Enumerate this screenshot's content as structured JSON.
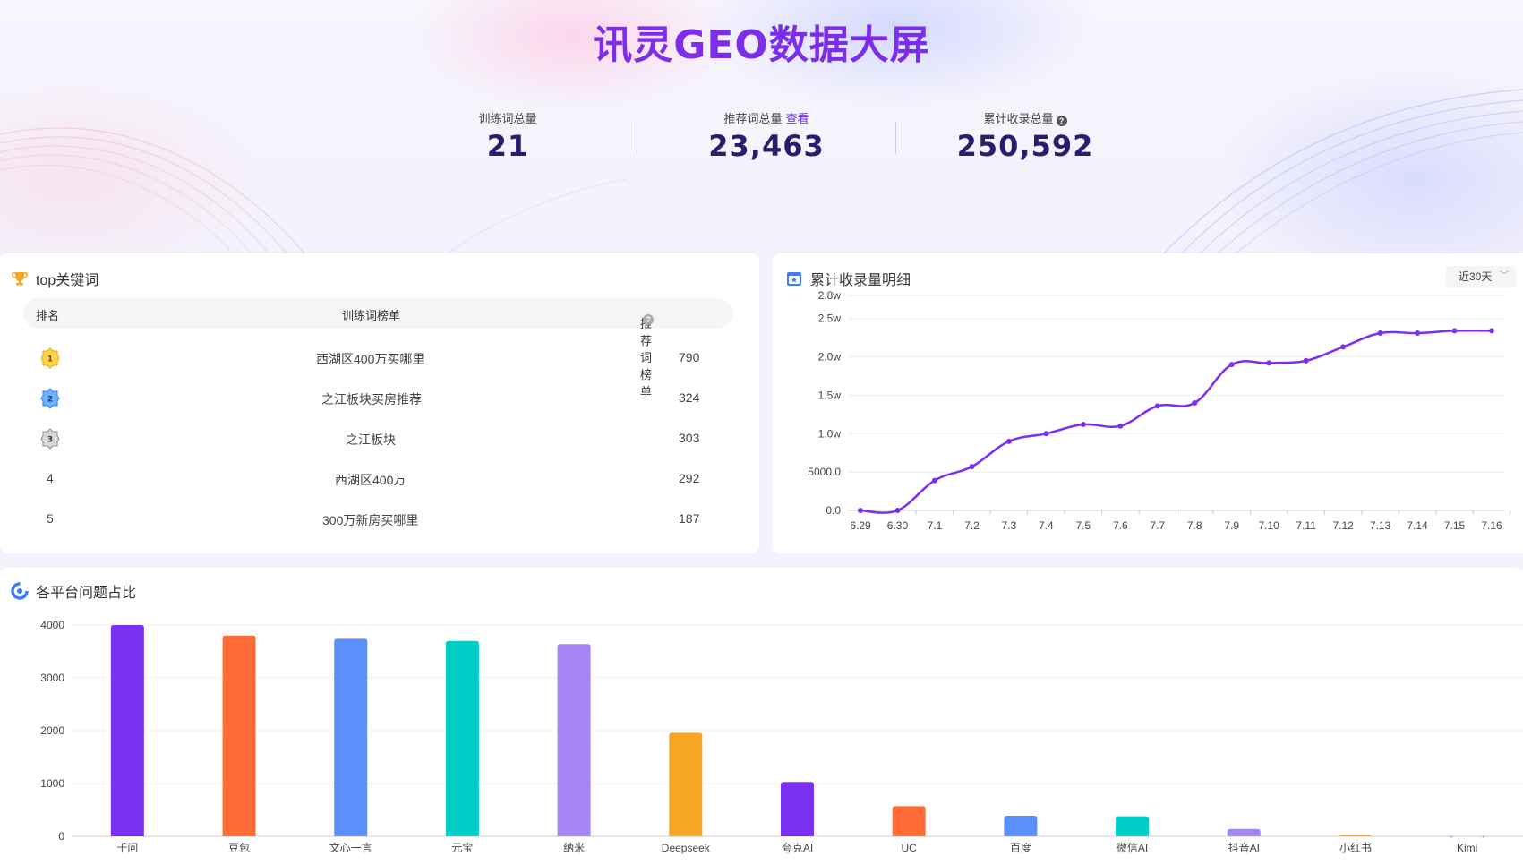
{
  "header": {
    "title": "讯灵GEO数据大屏"
  },
  "stats": [
    {
      "label": "训练词总量",
      "value": "21"
    },
    {
      "label": "推荐词总量",
      "link": "查看",
      "value": "23,463"
    },
    {
      "label": "累计收录总量",
      "help": "?",
      "value": "250,592"
    }
  ],
  "top_keywords": {
    "title": "top关键词",
    "columns": [
      "排名",
      "训练词榜单",
      "推荐词榜单"
    ],
    "help": "?",
    "rows": [
      {
        "rank": "1",
        "keyword": "西湖区400万买哪里",
        "count": "790"
      },
      {
        "rank": "2",
        "keyword": "之江板块买房推荐",
        "count": "324"
      },
      {
        "rank": "3",
        "keyword": "之江板块",
        "count": "303"
      },
      {
        "rank": "4",
        "keyword": "西湖区400万",
        "count": "292"
      },
      {
        "rank": "5",
        "keyword": "300万新房买哪里",
        "count": "187"
      }
    ]
  },
  "cumulative": {
    "title": "累计收录量明细",
    "range_select": "近30天"
  },
  "platforms": {
    "title": "各平台问题占比"
  },
  "chart_data": [
    {
      "type": "line",
      "x": [
        "6.29",
        "6.30",
        "7.1",
        "7.2",
        "7.3",
        "7.4",
        "7.5",
        "7.6",
        "7.7",
        "7.8",
        "7.9",
        "7.10",
        "7.11",
        "7.12",
        "7.13",
        "7.14",
        "7.15",
        "7.16"
      ],
      "values": [
        0,
        0,
        3900,
        5700,
        9000,
        10000,
        11200,
        11000,
        13600,
        14000,
        19000,
        19200,
        19500,
        21300,
        23100,
        23100,
        23400,
        23400
      ],
      "y_ticks": [
        "0.0",
        "5000.0",
        "1.0w",
        "1.5w",
        "2.0w",
        "2.5w",
        "2.8w"
      ],
      "y_tick_values": [
        0,
        5000,
        10000,
        15000,
        20000,
        25000,
        28000
      ],
      "ylim": [
        0,
        28000
      ],
      "color": "#7b2ff2",
      "grid": true
    },
    {
      "type": "bar",
      "categories": [
        "千问",
        "豆包",
        "文心一言",
        "元宝",
        "纳米",
        "Deepseek",
        "夸克AI",
        "UC",
        "百度",
        "微信AI",
        "抖音AI",
        "小红书",
        "Kimi"
      ],
      "values": [
        4000,
        3800,
        3740,
        3700,
        3640,
        1960,
        1030,
        570,
        390,
        380,
        140,
        30,
        0
      ],
      "colors": [
        "#7b2ff2",
        "#ff6b35",
        "#5b8ff9",
        "#00cfc7",
        "#a685f2",
        "#f5a623",
        "#7b2ff2",
        "#ff6b35",
        "#5b8ff9",
        "#00cfc7",
        "#a685f2",
        "#f5a623",
        "#7b2ff2"
      ],
      "y_ticks": [
        "0",
        "1000",
        "2000",
        "3000",
        "4000"
      ],
      "y_tick_values": [
        0,
        1000,
        2000,
        3000,
        4000
      ],
      "ylim": [
        0,
        4000
      ],
      "grid": true
    }
  ]
}
